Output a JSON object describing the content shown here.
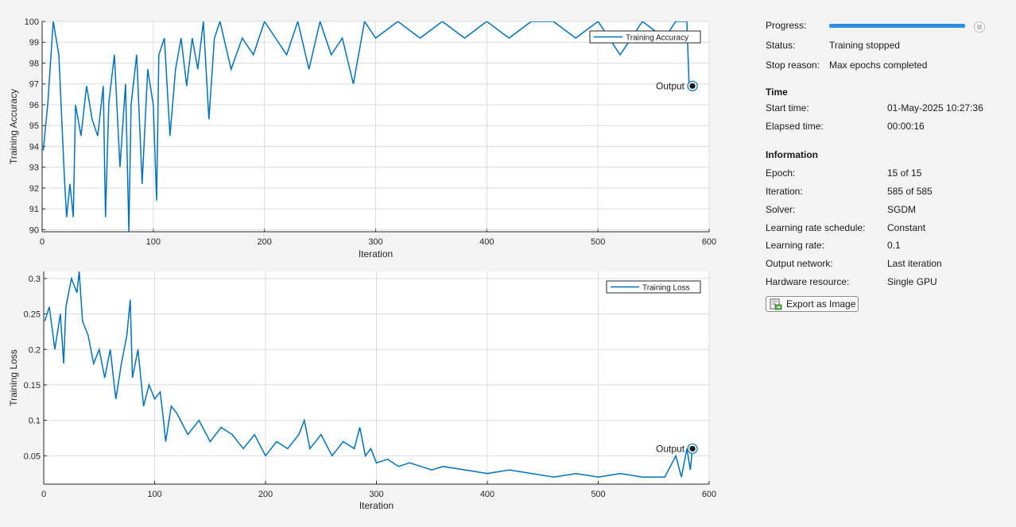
{
  "panel": {
    "progress_label": "Progress:",
    "progress": 1.0,
    "status_label": "Status:",
    "status_value": "Training stopped",
    "stop_reason_label": "Stop reason:",
    "stop_reason_value": "Max epochs completed",
    "time_header": "Time",
    "start_time_label": "Start time:",
    "start_time_value": "01-May-2025 10:27:36",
    "elapsed_label": "Elapsed time:",
    "elapsed_value": "00:00:16",
    "info_header": "Information",
    "epoch_label": "Epoch:",
    "epoch_value": "15 of 15",
    "iteration_label": "Iteration:",
    "iteration_value": "585 of 585",
    "solver_label": "Solver:",
    "solver_value": "SGDM",
    "lr_schedule_label": "Learning rate schedule:",
    "lr_schedule_value": "Constant",
    "lr_label": "Learning rate:",
    "lr_value": "0.1",
    "output_network_label": "Output network:",
    "output_network_value": "Last iteration",
    "hardware_label": "Hardware resource:",
    "hardware_value": "Single GPU",
    "export_label": "Export as Image",
    "export_icon": "export-image-icon",
    "stop_icon": "stop-icon"
  },
  "colors": {
    "line": "#0072bd",
    "progress": "#2e8ddf",
    "grid": "#dcdcdc"
  },
  "chart_data": [
    {
      "type": "line",
      "xlabel": "Iteration",
      "ylabel": "Training Accuracy",
      "xlim": [
        0,
        600
      ],
      "ylim": [
        89.9,
        100
      ],
      "xticks": [
        0,
        100,
        200,
        300,
        400,
        500,
        600
      ],
      "yticks": [
        90,
        91,
        92,
        93,
        94,
        95,
        96,
        97,
        98,
        99,
        100
      ],
      "grid": true,
      "legend": "top-right",
      "series": [
        {
          "name": "Training Accuracy",
          "x": [
            1,
            5,
            10,
            15,
            20,
            22,
            25,
            28,
            30,
            35,
            40,
            45,
            50,
            55,
            57,
            60,
            65,
            70,
            75,
            78,
            80,
            85,
            90,
            95,
            100,
            103,
            105,
            110,
            115,
            120,
            125,
            130,
            135,
            140,
            145,
            150,
            155,
            160,
            170,
            180,
            190,
            200,
            210,
            220,
            230,
            240,
            250,
            260,
            270,
            280,
            290,
            300,
            320,
            340,
            360,
            380,
            400,
            420,
            440,
            460,
            480,
            500,
            520,
            540,
            560,
            570,
            580,
            582,
            585
          ],
          "y": [
            93.8,
            96,
            100,
            98.4,
            92.5,
            90.6,
            92.2,
            90.6,
            96,
            94.5,
            96.9,
            95.3,
            94.5,
            96.9,
            90.6,
            96.1,
            98.4,
            93,
            97,
            89.9,
            96,
            98.4,
            92.2,
            97.7,
            96,
            91.4,
            98.4,
            99.2,
            94.5,
            97.7,
            99.2,
            96.9,
            99.2,
            97.7,
            100,
            95.3,
            99.2,
            100,
            97.7,
            99.2,
            98.4,
            100,
            99.2,
            98.4,
            100,
            97.7,
            100,
            98.4,
            99.2,
            97,
            100,
            99.2,
            100,
            99.2,
            100,
            99.2,
            100,
            99.2,
            100,
            100,
            99.2,
            100,
            98.4,
            100,
            99.2,
            100,
            100,
            96.9,
            96.9
          ]
        }
      ],
      "annotations": [
        "Output"
      ],
      "final_point": {
        "x": 585,
        "y": 96.9
      }
    },
    {
      "type": "line",
      "xlabel": "Iteration",
      "ylabel": "Training Loss",
      "xlim": [
        0,
        600
      ],
      "ylim": [
        0.01,
        0.31
      ],
      "xticks": [
        0,
        100,
        200,
        300,
        400,
        500,
        600
      ],
      "yticks": [
        0.05,
        0.1,
        0.15,
        0.2,
        0.25,
        0.3
      ],
      "grid": true,
      "legend": "top-right",
      "series": [
        {
          "name": "Training Loss",
          "x": [
            1,
            5,
            10,
            15,
            18,
            20,
            25,
            30,
            32,
            35,
            40,
            45,
            50,
            55,
            60,
            65,
            70,
            75,
            78,
            80,
            85,
            90,
            95,
            100,
            105,
            108,
            110,
            115,
            120,
            130,
            140,
            150,
            160,
            170,
            180,
            190,
            200,
            210,
            220,
            230,
            235,
            240,
            250,
            260,
            270,
            280,
            285,
            290,
            295,
            300,
            310,
            320,
            330,
            340,
            350,
            360,
            380,
            400,
            420,
            440,
            460,
            480,
            500,
            520,
            540,
            560,
            570,
            575,
            580,
            583,
            585
          ],
          "y": [
            0.24,
            0.26,
            0.2,
            0.25,
            0.18,
            0.26,
            0.3,
            0.28,
            0.31,
            0.24,
            0.22,
            0.18,
            0.2,
            0.16,
            0.2,
            0.13,
            0.18,
            0.22,
            0.27,
            0.16,
            0.2,
            0.12,
            0.15,
            0.13,
            0.14,
            0.1,
            0.07,
            0.12,
            0.11,
            0.08,
            0.1,
            0.07,
            0.09,
            0.08,
            0.06,
            0.08,
            0.05,
            0.07,
            0.06,
            0.08,
            0.1,
            0.06,
            0.08,
            0.05,
            0.07,
            0.06,
            0.09,
            0.05,
            0.06,
            0.04,
            0.045,
            0.035,
            0.04,
            0.035,
            0.03,
            0.035,
            0.03,
            0.025,
            0.03,
            0.025,
            0.02,
            0.025,
            0.02,
            0.025,
            0.02,
            0.02,
            0.05,
            0.02,
            0.06,
            0.03,
            0.06
          ]
        }
      ],
      "annotations": [
        "Output"
      ],
      "final_point": {
        "x": 585,
        "y": 0.06
      }
    }
  ]
}
